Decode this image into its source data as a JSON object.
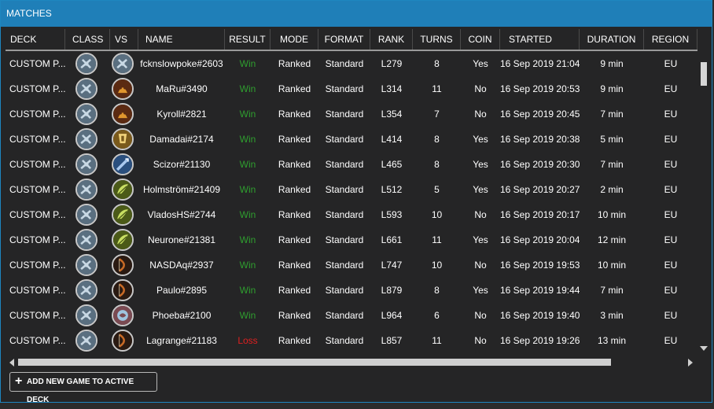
{
  "window": {
    "title": "MATCHES"
  },
  "columns": [
    "DECK",
    "CLASS",
    "VS",
    "NAME",
    "RESULT",
    "MODE",
    "FORMAT",
    "RANK",
    "TURNS",
    "COIN",
    "STARTED",
    "DURATION",
    "REGION"
  ],
  "rows": [
    {
      "deck": "CUSTOM P...",
      "class_icon": "warrior-class-icon",
      "vs_icon": "warrior-class-icon",
      "name": "fcknslowpoke#2603",
      "result": "Win",
      "mode": "Ranked",
      "format": "Standard",
      "rank": "L279",
      "turns": "8",
      "coin": "Yes",
      "started": "16 Sep 2019 21:04",
      "duration": "9 min",
      "region": "EU"
    },
    {
      "deck": "CUSTOM P...",
      "class_icon": "warrior-class-icon",
      "vs_icon": "warlock-class-icon",
      "name": "MaRu#3490",
      "result": "Win",
      "mode": "Ranked",
      "format": "Standard",
      "rank": "L314",
      "turns": "11",
      "coin": "No",
      "started": "16 Sep 2019 20:53",
      "duration": "9 min",
      "region": "EU"
    },
    {
      "deck": "CUSTOM P...",
      "class_icon": "warrior-class-icon",
      "vs_icon": "warlock-class-icon",
      "name": "Kyroll#2821",
      "result": "Win",
      "mode": "Ranked",
      "format": "Standard",
      "rank": "L354",
      "turns": "7",
      "coin": "No",
      "started": "16 Sep 2019 20:45",
      "duration": "7 min",
      "region": "EU"
    },
    {
      "deck": "CUSTOM P...",
      "class_icon": "warrior-class-icon",
      "vs_icon": "paladin-class-icon",
      "name": "Damadai#2174",
      "result": "Win",
      "mode": "Ranked",
      "format": "Standard",
      "rank": "L414",
      "turns": "8",
      "coin": "Yes",
      "started": "16 Sep 2019 20:38",
      "duration": "5 min",
      "region": "EU"
    },
    {
      "deck": "CUSTOM P...",
      "class_icon": "warrior-class-icon",
      "vs_icon": "mage-class-icon",
      "name": "Scizor#21130",
      "result": "Win",
      "mode": "Ranked",
      "format": "Standard",
      "rank": "L465",
      "turns": "8",
      "coin": "Yes",
      "started": "16 Sep 2019 20:30",
      "duration": "7 min",
      "region": "EU"
    },
    {
      "deck": "CUSTOM P...",
      "class_icon": "warrior-class-icon",
      "vs_icon": "druid-class-icon",
      "name": "Holmström#21409",
      "result": "Win",
      "mode": "Ranked",
      "format": "Standard",
      "rank": "L512",
      "turns": "5",
      "coin": "Yes",
      "started": "16 Sep 2019 20:27",
      "duration": "2 min",
      "region": "EU"
    },
    {
      "deck": "CUSTOM P...",
      "class_icon": "warrior-class-icon",
      "vs_icon": "druid-class-icon",
      "name": "VladosHS#2744",
      "result": "Win",
      "mode": "Ranked",
      "format": "Standard",
      "rank": "L593",
      "turns": "10",
      "coin": "No",
      "started": "16 Sep 2019 20:17",
      "duration": "10 min",
      "region": "EU"
    },
    {
      "deck": "CUSTOM P...",
      "class_icon": "warrior-class-icon",
      "vs_icon": "druid-class-icon",
      "name": "Neurone#21381",
      "result": "Win",
      "mode": "Ranked",
      "format": "Standard",
      "rank": "L661",
      "turns": "11",
      "coin": "Yes",
      "started": "16 Sep 2019 20:04",
      "duration": "12 min",
      "region": "EU"
    },
    {
      "deck": "CUSTOM P...",
      "class_icon": "warrior-class-icon",
      "vs_icon": "hunter-class-icon",
      "name": "NASDAq#2937",
      "result": "Win",
      "mode": "Ranked",
      "format": "Standard",
      "rank": "L747",
      "turns": "10",
      "coin": "No",
      "started": "16 Sep 2019 19:53",
      "duration": "10 min",
      "region": "EU"
    },
    {
      "deck": "CUSTOM P...",
      "class_icon": "warrior-class-icon",
      "vs_icon": "hunter-class-icon",
      "name": "Paulo#2895",
      "result": "Win",
      "mode": "Ranked",
      "format": "Standard",
      "rank": "L879",
      "turns": "8",
      "coin": "Yes",
      "started": "16 Sep 2019 19:44",
      "duration": "7 min",
      "region": "EU"
    },
    {
      "deck": "CUSTOM P...",
      "class_icon": "warrior-class-icon",
      "vs_icon": "shaman-class-icon",
      "name": "Phoeba#2100",
      "result": "Win",
      "mode": "Ranked",
      "format": "Standard",
      "rank": "L964",
      "turns": "6",
      "coin": "No",
      "started": "16 Sep 2019 19:40",
      "duration": "3 min",
      "region": "EU"
    },
    {
      "deck": "CUSTOM P...",
      "class_icon": "warrior-class-icon",
      "vs_icon": "hunter-class-icon",
      "name": "Lagrange#21183",
      "result": "Loss",
      "mode": "Ranked",
      "format": "Standard",
      "rank": "L857",
      "turns": "11",
      "coin": "No",
      "started": "16 Sep 2019 19:26",
      "duration": "13 min",
      "region": "EU"
    }
  ],
  "result_colors": {
    "Win": "#2f9e2f",
    "Loss": "#e02020"
  },
  "icon_colors": {
    "warrior-class-icon": [
      "#5a6f80",
      "#c8d8e4"
    ],
    "warlock-class-icon": [
      "#5b2a12",
      "#e0962e"
    ],
    "paladin-class-icon": [
      "#7a5a1c",
      "#f1d27a"
    ],
    "mage-class-icon": [
      "#2a4f7e",
      "#a9c8ee"
    ],
    "druid-class-icon": [
      "#4b5a18",
      "#c8de62"
    ],
    "hunter-class-icon": [
      "#2a1a12",
      "#c86a26"
    ],
    "shaman-class-icon": [
      "#7a4a52",
      "#9fc4e0"
    ]
  },
  "add_button": {
    "label": "ADD NEW GAME TO ACTIVE DECK"
  }
}
